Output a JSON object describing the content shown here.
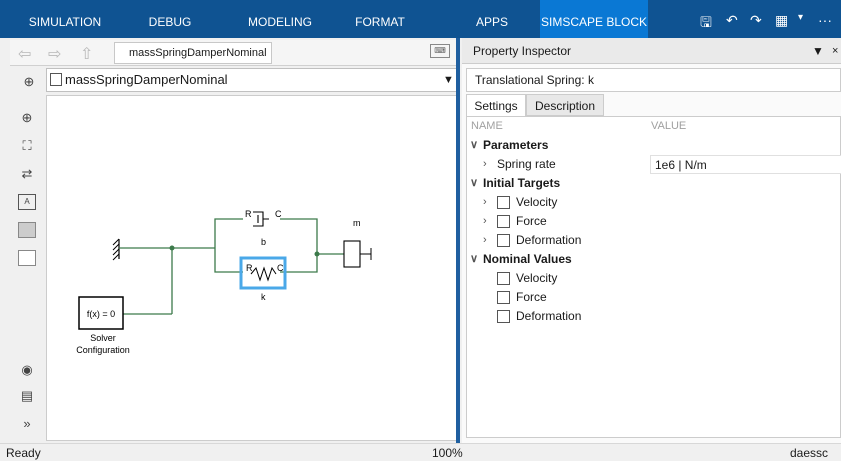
{
  "ribbon": {
    "tabs": [
      {
        "label": "SIMULATION"
      },
      {
        "label": "DEBUG"
      },
      {
        "label": "MODELING"
      },
      {
        "label": "FORMAT"
      },
      {
        "label": "APPS"
      },
      {
        "label": "SIMSCAPE BLOCK",
        "active": true
      }
    ],
    "more_label": "···",
    "colors": {
      "background": "#0f5392",
      "active_tab": "#0a78d4"
    }
  },
  "editor": {
    "model_tab_label": "massSpringDamperNominal",
    "address_path": "massSpringDamperNominal",
    "zoom": "100%",
    "status": "Ready"
  },
  "diagram": {
    "blocks": {
      "damper": {
        "port_left": "R",
        "port_right": "C",
        "name": "b"
      },
      "spring": {
        "port_left": "R",
        "port_right": "C",
        "name": "k",
        "selected": true
      },
      "mass": {
        "name": "m"
      },
      "solver": {
        "expression": "f(x) = 0",
        "caption_line1": "Solver",
        "caption_line2": "Configuration"
      }
    },
    "colors": {
      "line": "#3c7a4a",
      "selection": "#4aa8e8",
      "block": "#000000"
    }
  },
  "property_inspector": {
    "title": "Property Inspector",
    "block_title": "Translational Spring: k",
    "tabs": [
      {
        "label": "Settings",
        "active": true
      },
      {
        "label": "Description"
      }
    ],
    "columns": {
      "name": "NAME",
      "value": "VALUE"
    },
    "sections": [
      {
        "title": "Parameters",
        "rows": [
          {
            "label": "Spring rate",
            "value": "1e6 | N/m"
          }
        ]
      },
      {
        "title": "Initial Targets",
        "rows": [
          {
            "label": "Velocity"
          },
          {
            "label": "Force"
          },
          {
            "label": "Deformation"
          }
        ]
      },
      {
        "title": "Nominal Values",
        "rows": [
          {
            "label": "Velocity"
          },
          {
            "label": "Force"
          },
          {
            "label": "Deformation"
          }
        ]
      }
    ]
  },
  "statusbar": {
    "user": "daessc"
  }
}
